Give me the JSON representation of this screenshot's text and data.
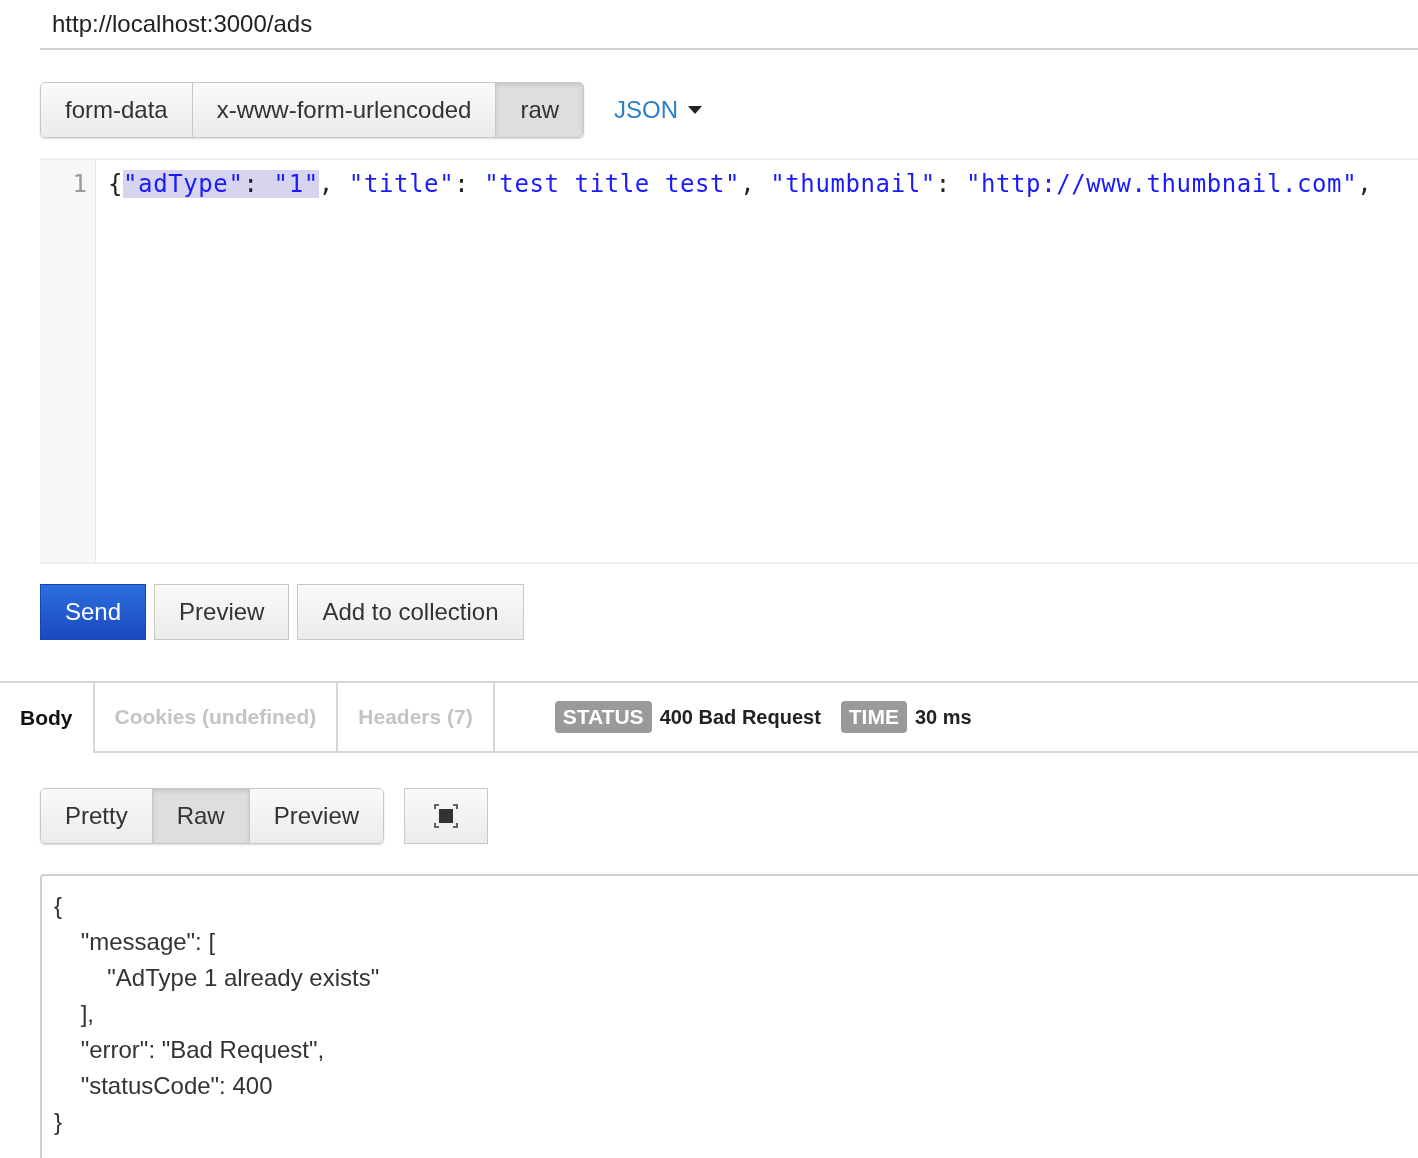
{
  "url": {
    "value": "http://localhost:3000/ads"
  },
  "body_modes": [
    {
      "label": "form-data",
      "selected": false
    },
    {
      "label": "x-www-form-urlencoded",
      "selected": false
    },
    {
      "label": "raw",
      "selected": true
    }
  ],
  "format_dropdown": {
    "label": "JSON"
  },
  "editor": {
    "lines": [
      {
        "number": "1",
        "tokens": [
          {
            "text": "{",
            "kind": "punct",
            "selected": false
          },
          {
            "text": "\"adType\"",
            "kind": "string",
            "selected": true
          },
          {
            "text": ": ",
            "kind": "punct",
            "selected": true
          },
          {
            "text": "\"1\"",
            "kind": "string",
            "selected": true
          },
          {
            "text": ", ",
            "kind": "punct",
            "selected": false
          },
          {
            "text": "\"title\"",
            "kind": "string",
            "selected": false
          },
          {
            "text": ": ",
            "kind": "punct",
            "selected": false
          },
          {
            "text": "\"test title test\"",
            "kind": "string",
            "selected": false
          },
          {
            "text": ", ",
            "kind": "punct",
            "selected": false
          },
          {
            "text": "\"thumbnail\"",
            "kind": "string",
            "selected": false
          },
          {
            "text": ": ",
            "kind": "punct",
            "selected": false
          },
          {
            "text": "\"http://www.thumbnail.com\"",
            "kind": "string",
            "selected": false
          },
          {
            "text": ",",
            "kind": "punct",
            "selected": false
          }
        ]
      }
    ]
  },
  "actions": [
    {
      "label": "Send",
      "kind": "primary"
    },
    {
      "label": "Preview",
      "kind": "default"
    },
    {
      "label": "Add to collection",
      "kind": "default"
    }
  ],
  "response_tabs": [
    {
      "label": "Body",
      "selected": true
    },
    {
      "label": "Cookies (undefined)",
      "selected": false
    },
    {
      "label": "Headers (7)",
      "selected": false
    }
  ],
  "status": {
    "label": "STATUS",
    "value": "400 Bad Request"
  },
  "time": {
    "label": "TIME",
    "value": "30 ms"
  },
  "view_modes": [
    {
      "label": "Pretty",
      "selected": false
    },
    {
      "label": "Raw",
      "selected": true
    },
    {
      "label": "Preview",
      "selected": false
    }
  ],
  "response_body": "{\n    \"message\": [\n        \"AdType 1 already exists\"\n    ],\n    \"error\": \"Bad Request\",\n    \"statusCode\": 400\n}"
}
